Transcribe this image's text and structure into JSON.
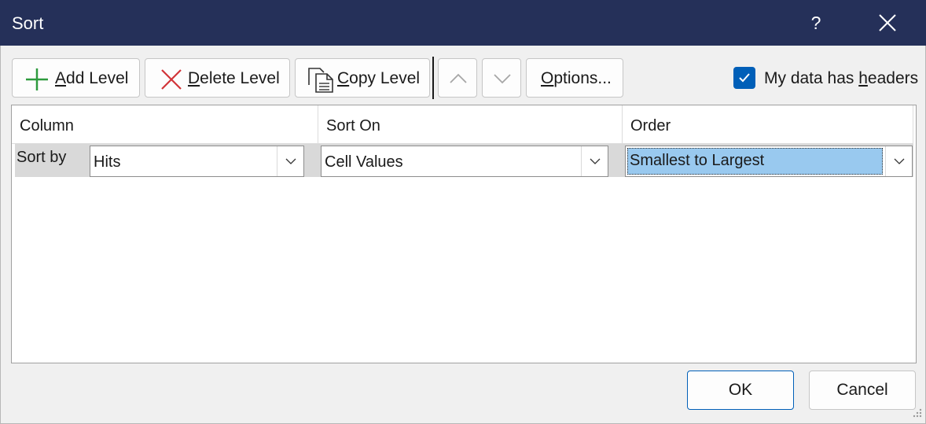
{
  "window": {
    "title": "Sort",
    "help_label": "?"
  },
  "toolbar": {
    "add_level": {
      "mnemonic": "A",
      "rest": "dd Level",
      "icon": "plus-icon",
      "color": "#2e9b3e"
    },
    "delete_level": {
      "mnemonic": "D",
      "rest": "elete Level",
      "icon": "x-icon",
      "color": "#d13438"
    },
    "copy_level": {
      "mnemonic": "C",
      "rest": "opy Level",
      "icon": "copy-icon"
    },
    "move_up": {
      "icon": "chevron-up-icon",
      "enabled": false
    },
    "move_down": {
      "icon": "chevron-down-icon",
      "enabled": false
    },
    "options": {
      "mnemonic": "O",
      "rest": "ptions..."
    }
  },
  "headers_checkbox": {
    "checked": true,
    "label_before": "My data has ",
    "label_mnemonic": "h",
    "label_after": "eaders",
    "accent": "#005fb8"
  },
  "grid": {
    "columns": [
      "Column",
      "Sort On",
      "Order"
    ],
    "rows": [
      {
        "label": "Sort by",
        "column": "Hits",
        "sort_on": "Cell Values",
        "order": "Smallest to Largest"
      }
    ]
  },
  "buttons": {
    "ok": "OK",
    "cancel": "Cancel"
  }
}
